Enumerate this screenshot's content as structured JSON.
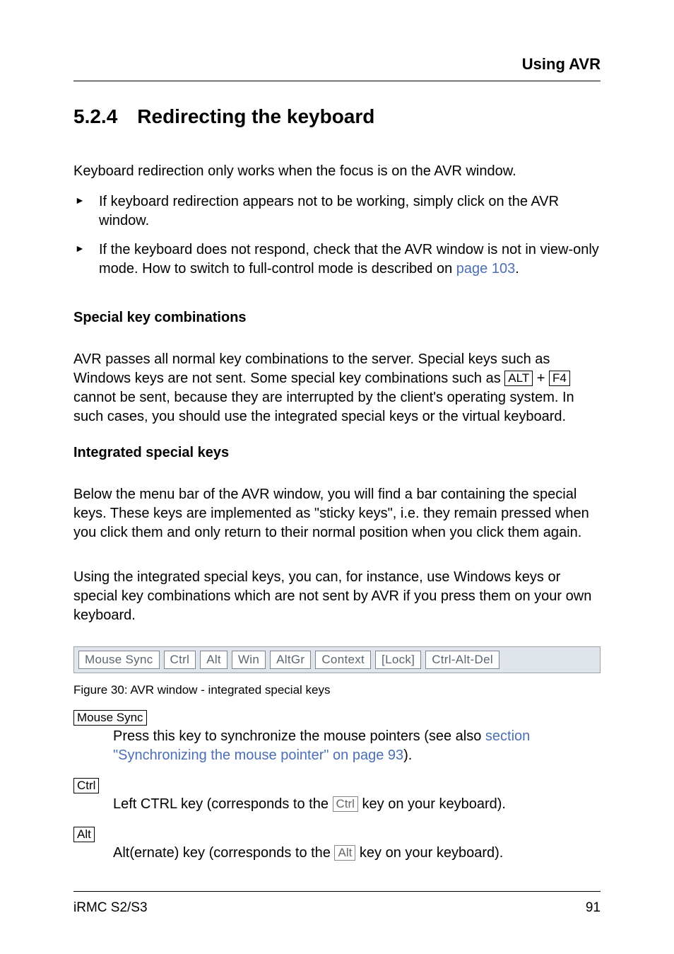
{
  "header": {
    "title": "Using AVR"
  },
  "section": {
    "number": "5.2.4",
    "title": "Redirecting the keyboard"
  },
  "intro": "Keyboard redirection only works when the focus is on the AVR window.",
  "bullets": [
    "If keyboard redirection appears not to be working, simply click on the AVR window.",
    ""
  ],
  "bullet2": {
    "part1": "If the keyboard does not respond, check that the AVR window is not in view-only mode. How to switch to full-control mode is described on ",
    "link": "page 103",
    "part2": "."
  },
  "special_combos": {
    "heading": "Special key combinations",
    "text_part1": "AVR passes all normal key combinations to the server. Special keys such as Windows keys are not sent. Some special key combinations such as ",
    "key1": "ALT",
    "plus": " + ",
    "key2": "F4",
    "text_part2": " cannot be sent, because they are interrupted by the client's operating system. In such cases, you should use the integrated special keys or the virtual keyboard."
  },
  "integrated": {
    "heading": "Integrated special keys",
    "para1": "Below the menu bar of the AVR window, you will find a bar containing the special keys. These keys are implemented as \"sticky keys\", i.e. they remain pressed when you click them and only return to their normal position when you click them again.",
    "para2": "Using the integrated special keys, you can, for instance, use Windows keys or special key combinations which are not sent by AVR if you press them on your own keyboard."
  },
  "keybar": [
    "Mouse Sync",
    "Ctrl",
    "Alt",
    "Win",
    "AltGr",
    "Context",
    "[Lock]",
    "Ctrl-Alt-Del"
  ],
  "figure_caption": "Figure 30:  AVR window - integrated special keys",
  "defs": {
    "mouse_sync": {
      "term": "Mouse Sync",
      "desc_part1": "Press this key to synchronize the mouse pointers (see also ",
      "link": "section \"Synchronizing the mouse pointer\" on page 93",
      "desc_part2": ")."
    },
    "ctrl": {
      "term": "Ctrl",
      "desc_part1": "Left CTRL key (corresponds to the ",
      "key": "Ctrl",
      "desc_part2": " key on your keyboard)."
    },
    "alt": {
      "term": "Alt",
      "desc_part1": " Alt(ernate) key (corresponds to the ",
      "key": "Alt",
      "desc_part2": " key on your keyboard)."
    }
  },
  "footer": {
    "left": "iRMC S2/S3",
    "right": "91"
  }
}
